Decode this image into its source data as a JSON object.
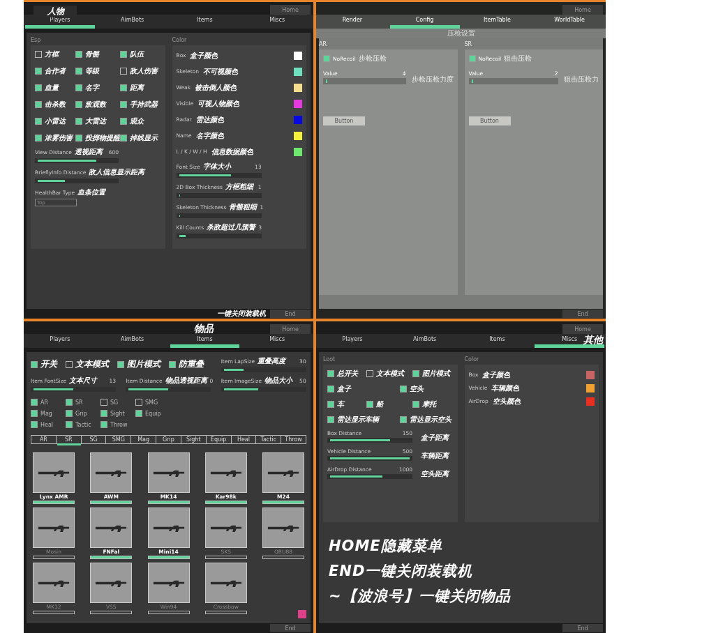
{
  "players_panel": {
    "title": "人物",
    "home": "Home",
    "tabs": [
      {
        "label": "Players",
        "selected": true
      },
      {
        "label": "AimBots",
        "selected": false
      },
      {
        "label": "Items",
        "selected": false
      },
      {
        "label": "Miscs",
        "selected": false
      }
    ],
    "esp": {
      "heading": "Esp",
      "checks": [
        {
          "label": "方框",
          "checked": false
        },
        {
          "label": "骨骼",
          "checked": true
        },
        {
          "label": "队伍",
          "checked": true
        },
        {
          "label": "合作者",
          "checked": true
        },
        {
          "label": "等级",
          "checked": true
        },
        {
          "label": "敌人伤害",
          "checked": false
        },
        {
          "label": "血量",
          "checked": true
        },
        {
          "label": "名字",
          "checked": true
        },
        {
          "label": "距离",
          "checked": true
        },
        {
          "label": "击杀数",
          "checked": true
        },
        {
          "label": "敌观数",
          "checked": true
        },
        {
          "label": "手持武器",
          "checked": true
        },
        {
          "label": "小雷达",
          "checked": true
        },
        {
          "label": "大雷达",
          "checked": true
        },
        {
          "label": "观众",
          "checked": true
        },
        {
          "label": "浓雾伤害",
          "checked": true
        },
        {
          "label": "投掷物提醒",
          "checked": true
        },
        {
          "label": "掉线显示",
          "checked": true
        }
      ],
      "sliders": [
        {
          "label": "View Distance",
          "note": "透视距离",
          "reading": "600",
          "level": 0.75
        },
        {
          "label": "BrieflyInfo Distance",
          "note": "敌人信息显示距离",
          "level": 0.35
        }
      ],
      "healthbar": {
        "label": "HealthBar Type",
        "note": "血条位置",
        "value": "Top"
      }
    },
    "color": {
      "heading": "Color",
      "swatches": [
        {
          "label": "Box",
          "note": "盒子颜色",
          "color": "#ffffff"
        },
        {
          "label": "Skeleton",
          "note": "不可视颜色",
          "color": "#6ee0c0"
        },
        {
          "label": "Weak",
          "note": "被击倒人颜色",
          "color": "#f5df8f"
        },
        {
          "label": "Visible",
          "note": "可视人物颜色",
          "color": "#e838e0"
        },
        {
          "label": "Radar",
          "note": "雷达颜色",
          "color": "#0808e0"
        },
        {
          "label": "Name",
          "note": "名字颜色",
          "color": "#f5f03c"
        },
        {
          "label": "L / K / W / H",
          "note": "信息数据颜色",
          "color": "#6ee86e"
        }
      ],
      "sliders": [
        {
          "label": "Font Size",
          "note": "字体大小",
          "reading": "13",
          "level": 0.65
        },
        {
          "label": "2D Box Thickness",
          "note": "方框粗细",
          "reading": "1",
          "level": 0.01
        },
        {
          "label": "Skeleton Thickness",
          "note": "骨骼粗细",
          "reading": "1",
          "level": 0.01
        },
        {
          "label": "Kill Counts",
          "note": "杀敌超过几预警",
          "reading": "3",
          "level": 0.08
        }
      ]
    },
    "footer": {
      "note": "一键关闭装载机",
      "button": "End"
    }
  },
  "config_panel": {
    "home": "Home",
    "tabs": [
      {
        "label": "Render",
        "selected": false
      },
      {
        "label": "Config",
        "selected": true
      },
      {
        "label": "ItemTable",
        "selected": false
      },
      {
        "label": "WorldTable",
        "selected": false
      }
    ],
    "subtitle": "压枪设置",
    "groups": [
      {
        "heading": "AR",
        "check": {
          "label": "NoRecoil",
          "note": "步枪压枪",
          "checked": true
        },
        "slider": {
          "label": "Value",
          "reading": "4",
          "note": "步枪压枪力度",
          "level": 0.02
        },
        "button": "Button"
      },
      {
        "heading": "SR",
        "check": {
          "label": "NoRecoil",
          "note": "狙击压枪",
          "checked": true
        },
        "slider": {
          "label": "Value",
          "reading": "2",
          "note": "狙击压枪力",
          "level": 0.02
        },
        "button": "Button"
      }
    ],
    "footer": {
      "button": "End"
    }
  },
  "items_panel": {
    "title": "物品",
    "home": "Home",
    "tabs": [
      {
        "label": "Players",
        "selected": false
      },
      {
        "label": "AimBots",
        "selected": false
      },
      {
        "label": "Items",
        "selected": true
      },
      {
        "label": "Miscs",
        "selected": false
      }
    ],
    "modes": [
      {
        "label": "开关",
        "checked": true
      },
      {
        "label": "文本模式",
        "checked": false
      },
      {
        "label": "图片模式",
        "checked": true
      },
      {
        "label": "防重叠",
        "checked": true
      }
    ],
    "sliders": [
      {
        "label": "Item LapSize",
        "note": "重叠高度",
        "reading": "30",
        "level": 0.25
      },
      {
        "label": "Item FontSize",
        "note": "文本尺寸",
        "reading": "13",
        "level": 0.5
      },
      {
        "label": "Item Distance",
        "note": "物品透视距离",
        "reading": "0",
        "level": 0.5
      },
      {
        "label": "Item ImageSize",
        "note": "物品大小",
        "reading": "50",
        "level": 0.43
      }
    ],
    "categories": [
      {
        "label": "AR",
        "checked": true
      },
      {
        "label": "SR",
        "checked": true
      },
      {
        "label": "SG",
        "checked": false
      },
      {
        "label": "SMG",
        "checked": false
      },
      {
        "label": "Mag",
        "checked": true
      },
      {
        "label": "Grip",
        "checked": true
      },
      {
        "label": "Sight",
        "checked": true
      },
      {
        "label": "Equip",
        "checked": true
      },
      {
        "label": "Heal",
        "checked": true
      },
      {
        "label": "Tactic",
        "checked": true
      },
      {
        "label": "Throw",
        "checked": true
      }
    ],
    "filter_tabs": [
      {
        "label": "AR",
        "selected": false
      },
      {
        "label": "SR",
        "selected": true
      },
      {
        "label": "SG",
        "selected": false
      },
      {
        "label": "SMG",
        "selected": false
      },
      {
        "label": "Mag",
        "selected": false
      },
      {
        "label": "Grip",
        "selected": false
      },
      {
        "label": "Sight",
        "selected": false
      },
      {
        "label": "Equip",
        "selected": false
      },
      {
        "label": "Heal",
        "selected": false
      },
      {
        "label": "Tactic",
        "selected": false
      },
      {
        "label": "Throw",
        "selected": false
      }
    ],
    "weapons": [
      {
        "name": "Lynx AMR",
        "enabled": true
      },
      {
        "name": "AWM",
        "enabled": true
      },
      {
        "name": "MK14",
        "enabled": true
      },
      {
        "name": "Kar98k",
        "enabled": true
      },
      {
        "name": "M24",
        "enabled": true
      },
      {
        "name": "Mosin",
        "enabled": false
      },
      {
        "name": "FNFal",
        "enabled": true
      },
      {
        "name": "Mini14",
        "enabled": true
      },
      {
        "name": "SKS",
        "enabled": false
      },
      {
        "name": "QBU88",
        "enabled": false
      },
      {
        "name": "MK12",
        "enabled": false
      },
      {
        "name": "VSS",
        "enabled": false
      },
      {
        "name": "Win94",
        "enabled": false
      },
      {
        "name": "Crossbow",
        "enabled": false
      }
    ],
    "swatch": {
      "color": "#e0408a"
    },
    "footer": {
      "button": "End"
    }
  },
  "miscs_panel": {
    "title": "其他",
    "home": "Home",
    "tabs": [
      {
        "label": "Players",
        "selected": false
      },
      {
        "label": "AimBots",
        "selected": false
      },
      {
        "label": "Items",
        "selected": false
      },
      {
        "label": "Miscs",
        "selected": true
      }
    ],
    "loot": {
      "heading": "Loot",
      "check_rows": [
        [
          {
            "label": "总开关",
            "checked": true
          },
          {
            "label": "文本模式",
            "checked": false
          },
          {
            "label": "图片模式",
            "checked": true
          }
        ],
        [
          {
            "label": "盒子",
            "checked": true
          },
          {
            "label": "空头",
            "checked": true
          }
        ],
        [
          {
            "label": "车",
            "checked": true
          },
          {
            "label": "船",
            "checked": true
          },
          {
            "label": "摩托",
            "checked": true
          }
        ],
        [
          {
            "label": "雷达显示车辆",
            "checked": true
          },
          {
            "label": "雷达显示空头",
            "checked": true
          }
        ]
      ],
      "sliders": [
        {
          "label": "Box Distance",
          "note": "盒子距离",
          "reading": "150",
          "level": 0.75
        },
        {
          "label": "Vehicle Distance",
          "note": "车辆距离",
          "reading": "500",
          "level": 1.0
        },
        {
          "label": "AirDrop Distance",
          "note": "空头距离",
          "reading": "1000",
          "level": 0.66
        }
      ]
    },
    "color": {
      "heading": "Color",
      "swatches": [
        {
          "label": "Box",
          "note": "盒子颜色",
          "color": "#c86464"
        },
        {
          "label": "Vehicle",
          "note": "车辆颜色",
          "color": "#f0a030"
        },
        {
          "label": "AirDrop",
          "note": "空头颜色",
          "color": "#e83020"
        }
      ]
    },
    "notes": [
      "HOME隐藏菜单",
      "END一键关闭装载机",
      "~【波浪号】一键关闭物品"
    ],
    "footer": {
      "button": "End"
    }
  }
}
